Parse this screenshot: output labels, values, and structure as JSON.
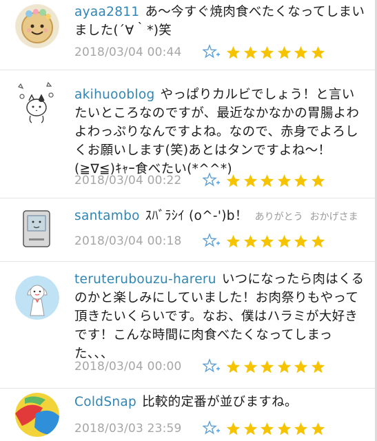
{
  "comments": [
    {
      "user": "ayaa2811",
      "text": "あ～今すぐ焼肉食べたくなってしまいました(´∀｀*)笑",
      "time": "2018/03/04 00:44",
      "rating": 6
    },
    {
      "user": "akihuooblog",
      "text": "やっぱりカルビでしょう！と言いたいところなのですが、最近なかなかの胃腸よわよわっぷりなんですよね。なので、赤身でよろしくお願いします(笑)あとはタンですよね～！(≧∇≦)ｷｬｰ食べたい(*^^*)",
      "time": "2018/03/04 00:22",
      "rating": 6
    },
    {
      "user": "santambo",
      "text": "ｽﾊﾞﾗｼｲ (o^-')b！",
      "extra1": "ありがとう",
      "extra2": "おかげさま",
      "time": "2018/03/04 00:18",
      "rating": 6
    },
    {
      "user": "teruterubouzu-hareru",
      "text": "いつになったら肉はくるのかと楽しみにしていました！お肉祭りもやって頂きたいくらいです。なお、僕はハラミが大好きです！こんな時間に肉食べたくなってしまった、、、",
      "time": "2018/03/04 00:00",
      "rating": 6
    },
    {
      "user": "ColdSnap",
      "text": "比較的定番が並びますね。",
      "time": "2018/03/03 23:59",
      "rating": 6
    }
  ],
  "colors": {
    "username": "#2f86b5",
    "star": "#f5c300",
    "timestamp": "#a6a6a6",
    "add_star_icon": "#5b9fd6"
  },
  "icons": {
    "add_star": "star-plus-icon",
    "rating_star": "star-icon"
  }
}
